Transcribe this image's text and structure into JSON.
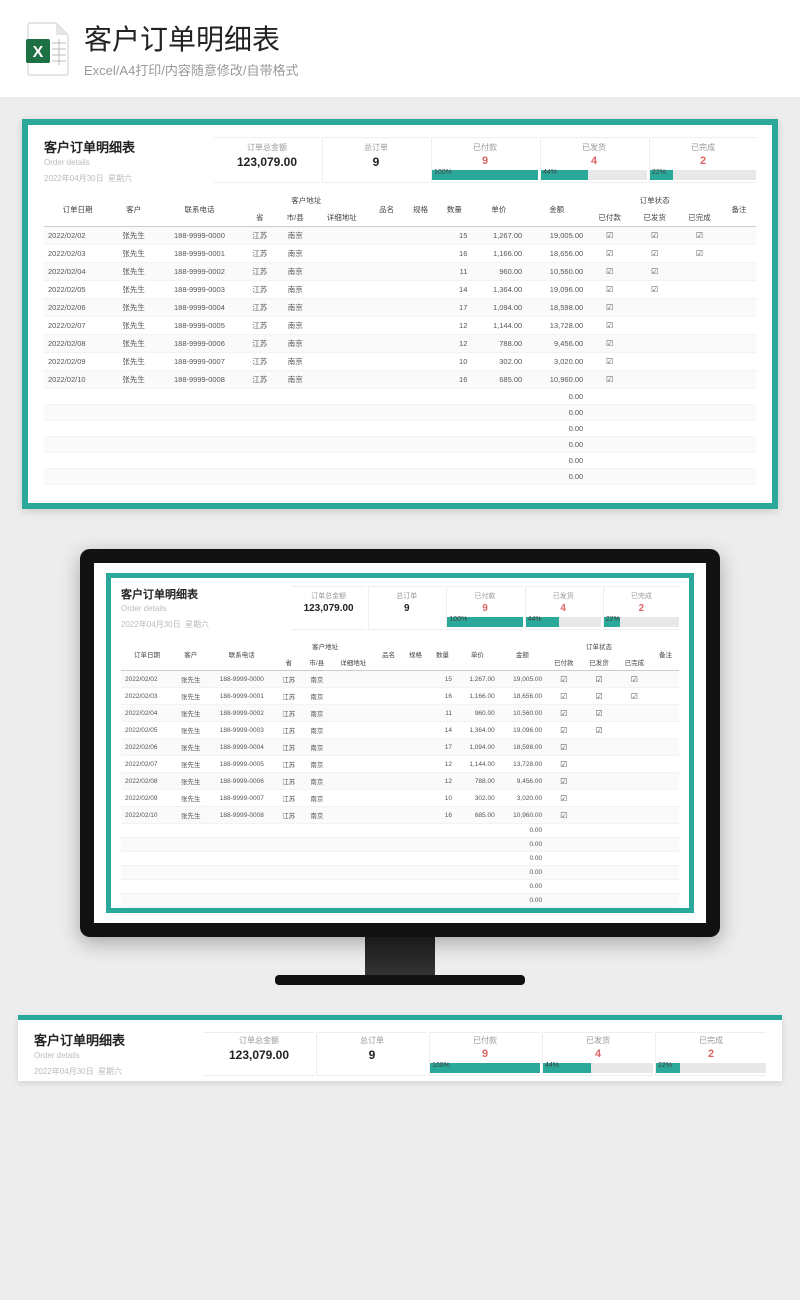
{
  "page": {
    "title": "客户订单明细表",
    "subtitle": "Excel/A4打印/内容随意修改/自带格式"
  },
  "sheet": {
    "title": "客户订单明细表",
    "subtitle_en": "Order details",
    "date": "2022年04月30日",
    "weekday": "星期六"
  },
  "kpi": {
    "total_amount_label": "订单总金额",
    "total_amount": "123,079.00",
    "total_orders_label": "总订单",
    "total_orders": "9",
    "paid_label": "已付款",
    "paid": "9",
    "paid_pct_text": "100%",
    "paid_pct": 100,
    "shipped_label": "已发货",
    "shipped": "4",
    "shipped_pct_text": "44%",
    "shipped_pct": 44,
    "done_label": "已完成",
    "done": "2",
    "done_pct_text": "22%",
    "done_pct": 22
  },
  "headers": {
    "order_date": "订单日期",
    "customer": "客户",
    "phone": "联系电话",
    "addr_group": "客户地址",
    "province": "省",
    "city": "市/县",
    "detail_addr": "详细地址",
    "product": "品名",
    "spec": "规格",
    "qty": "数量",
    "price": "单价",
    "amount": "金额",
    "status_group": "订单状态",
    "paid": "已付款",
    "shipped": "已发货",
    "done": "已完成",
    "remark": "备注"
  },
  "rows": [
    {
      "date": "2022/02/02",
      "cust": "张先生",
      "phone": "188-9999-0000",
      "prov": "江苏",
      "city": "南京",
      "qty": "15",
      "price": "1,267.00",
      "amt": "19,005.00",
      "p": "☑",
      "s": "☑",
      "d": "☑"
    },
    {
      "date": "2022/02/03",
      "cust": "张先生",
      "phone": "188-9999-0001",
      "prov": "江苏",
      "city": "南京",
      "qty": "16",
      "price": "1,166.00",
      "amt": "18,656.00",
      "p": "☑",
      "s": "☑",
      "d": "☑"
    },
    {
      "date": "2022/02/04",
      "cust": "张先生",
      "phone": "188-9999-0002",
      "prov": "江苏",
      "city": "南京",
      "qty": "11",
      "price": "960.00",
      "amt": "10,560.00",
      "p": "☑",
      "s": "☑",
      "d": ""
    },
    {
      "date": "2022/02/05",
      "cust": "张先生",
      "phone": "188-9999-0003",
      "prov": "江苏",
      "city": "南京",
      "qty": "14",
      "price": "1,364.00",
      "amt": "19,096.00",
      "p": "☑",
      "s": "☑",
      "d": ""
    },
    {
      "date": "2022/02/06",
      "cust": "张先生",
      "phone": "188-9999-0004",
      "prov": "江苏",
      "city": "南京",
      "qty": "17",
      "price": "1,094.00",
      "amt": "18,598.00",
      "p": "☑",
      "s": "",
      "d": ""
    },
    {
      "date": "2022/02/07",
      "cust": "张先生",
      "phone": "188-9999-0005",
      "prov": "江苏",
      "city": "南京",
      "qty": "12",
      "price": "1,144.00",
      "amt": "13,728.00",
      "p": "☑",
      "s": "",
      "d": ""
    },
    {
      "date": "2022/02/08",
      "cust": "张先生",
      "phone": "188-9999-0006",
      "prov": "江苏",
      "city": "南京",
      "qty": "12",
      "price": "788.00",
      "amt": "9,456.00",
      "p": "☑",
      "s": "",
      "d": ""
    },
    {
      "date": "2022/02/09",
      "cust": "张先生",
      "phone": "188-9999-0007",
      "prov": "江苏",
      "city": "南京",
      "qty": "10",
      "price": "302.00",
      "amt": "3,020.00",
      "p": "☑",
      "s": "",
      "d": ""
    },
    {
      "date": "2022/02/10",
      "cust": "张先生",
      "phone": "188-9999-0008",
      "prov": "江苏",
      "city": "南京",
      "qty": "16",
      "price": "685.00",
      "amt": "10,960.00",
      "p": "☑",
      "s": "",
      "d": ""
    }
  ],
  "empty_amount": "0.00",
  "empty_rows": 6,
  "chart_data": {
    "type": "table",
    "title": "客户订单明细表 KPI",
    "categories": [
      "订单总金额",
      "总订单",
      "已付款",
      "已发货",
      "已完成"
    ],
    "values": [
      123079.0,
      9,
      9,
      4,
      2
    ],
    "percentages": {
      "已付款": 100,
      "已发货": 44,
      "已完成": 22
    }
  }
}
